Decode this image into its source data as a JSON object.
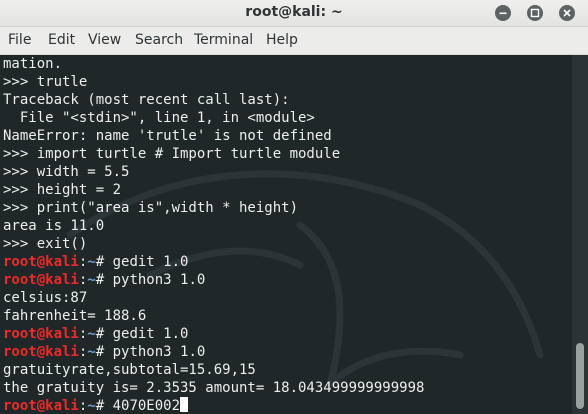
{
  "window": {
    "title": "root@kali: ~"
  },
  "menu": [
    "File",
    "Edit",
    "View",
    "Search",
    "Terminal",
    "Help"
  ],
  "terminal": {
    "lines": [
      "mation.",
      ">>> trutle",
      "Traceback (most recent call last):",
      "  File \"<stdin>\", line 1, in <module>",
      "NameError: name 'trutle' is not defined",
      ">>> import turtle # Import turtle module",
      ">>> width = 5.5",
      ">>> height = 2",
      ">>> print(\"area is\",width * height)",
      "area is 11.0",
      ">>> exit()"
    ],
    "prompt_user": "root@kali",
    "prompt_sep": ":",
    "prompt_path": "~",
    "prompt_symbol": "# ",
    "session": [
      {
        "cmd": "gedit 1.0",
        "output": []
      },
      {
        "cmd": "python3 1.0",
        "output": [
          "celsius:87",
          "fahrenheit= 188.6"
        ]
      },
      {
        "cmd": "gedit 1.0",
        "output": []
      },
      {
        "cmd": "python3 1.0",
        "output": [
          "gratuityrate,subtotal=15.69,15",
          "the gratuity is= 2.3535 amount= 18.043499999999998"
        ]
      },
      {
        "cmd": "4070E002",
        "output": []
      }
    ]
  },
  "colors": {
    "terminal_bg": "#1f2729",
    "prompt_user": "#ef2929",
    "prompt_path": "#729fcf",
    "text": "#eeeeec"
  }
}
